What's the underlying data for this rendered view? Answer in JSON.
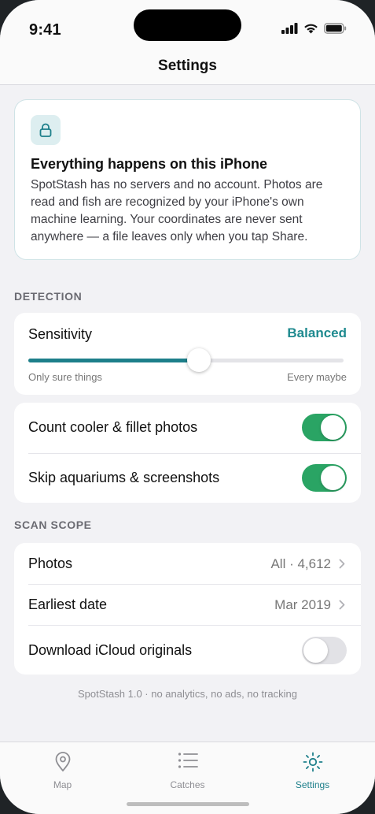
{
  "status_bar": {
    "time": "9:41"
  },
  "nav": {
    "title": "Settings"
  },
  "privacy": {
    "icon": "lock-icon",
    "title": "Everything happens on this iPhone",
    "body": "SpotStash has no servers and no account. Photos are read and fish are recognized by your iPhone's own machine learning. Your coordinates are never sent anywhere — a file leaves only when you tap Share."
  },
  "detection": {
    "header": "DETECTION",
    "sensitivity": {
      "label": "Sensitivity",
      "value": "Balanced",
      "level": 0.54,
      "min_label": "Only sure things",
      "max_label": "Every maybe"
    },
    "toggles": [
      {
        "label": "Count cooler & fillet photos",
        "on": true
      },
      {
        "label": "Skip aquariums & screenshots",
        "on": true
      }
    ]
  },
  "scan_scope": {
    "header": "SCAN SCOPE",
    "photos": {
      "label": "Photos",
      "value": "All · 4,612"
    },
    "earliest": {
      "label": "Earliest date",
      "value": "Mar 2019"
    },
    "icloud": {
      "label": "Download iCloud originals",
      "on": false
    }
  },
  "footer": "SpotStash 1.0 · no analytics, no ads, no tracking",
  "tabs": [
    {
      "label": "Map",
      "icon": "map-pin-icon",
      "active": false
    },
    {
      "label": "Catches",
      "icon": "list-icon",
      "active": false
    },
    {
      "label": "Settings",
      "icon": "gear-icon",
      "active": true
    }
  ],
  "colors": {
    "accent": "#1d7f8a",
    "toggle_on": "#2aa464",
    "background": "#f2f2f5"
  }
}
